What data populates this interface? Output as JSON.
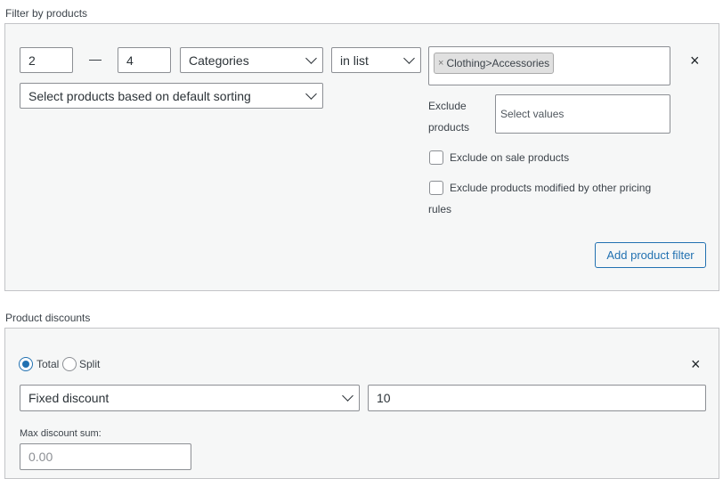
{
  "filter_section": {
    "title": "Filter by products",
    "qty_from": "2",
    "range_dash": "—",
    "qty_to": "4",
    "type_select": "Categories",
    "method_select": "in list",
    "selected_tag": "Clothing>Accessories",
    "tag_remove": "×",
    "sorting_select": "Select products based on default sorting",
    "exclude_label": "Exclude products",
    "exclude_placeholder": "Select values",
    "exclude_on_sale_label": "Exclude on sale products",
    "exclude_modified_label": "Exclude products modified by other pricing rules",
    "add_filter_button": "Add product filter",
    "remove_icon": "×"
  },
  "discount_section": {
    "title": "Product discounts",
    "radio_total_label": "Total",
    "radio_split_label": "Split",
    "discount_type_select": "Fixed discount",
    "discount_value": "10",
    "max_discount_label": "Max discount sum:",
    "max_discount_placeholder": "0.00",
    "remove_icon": "×"
  }
}
